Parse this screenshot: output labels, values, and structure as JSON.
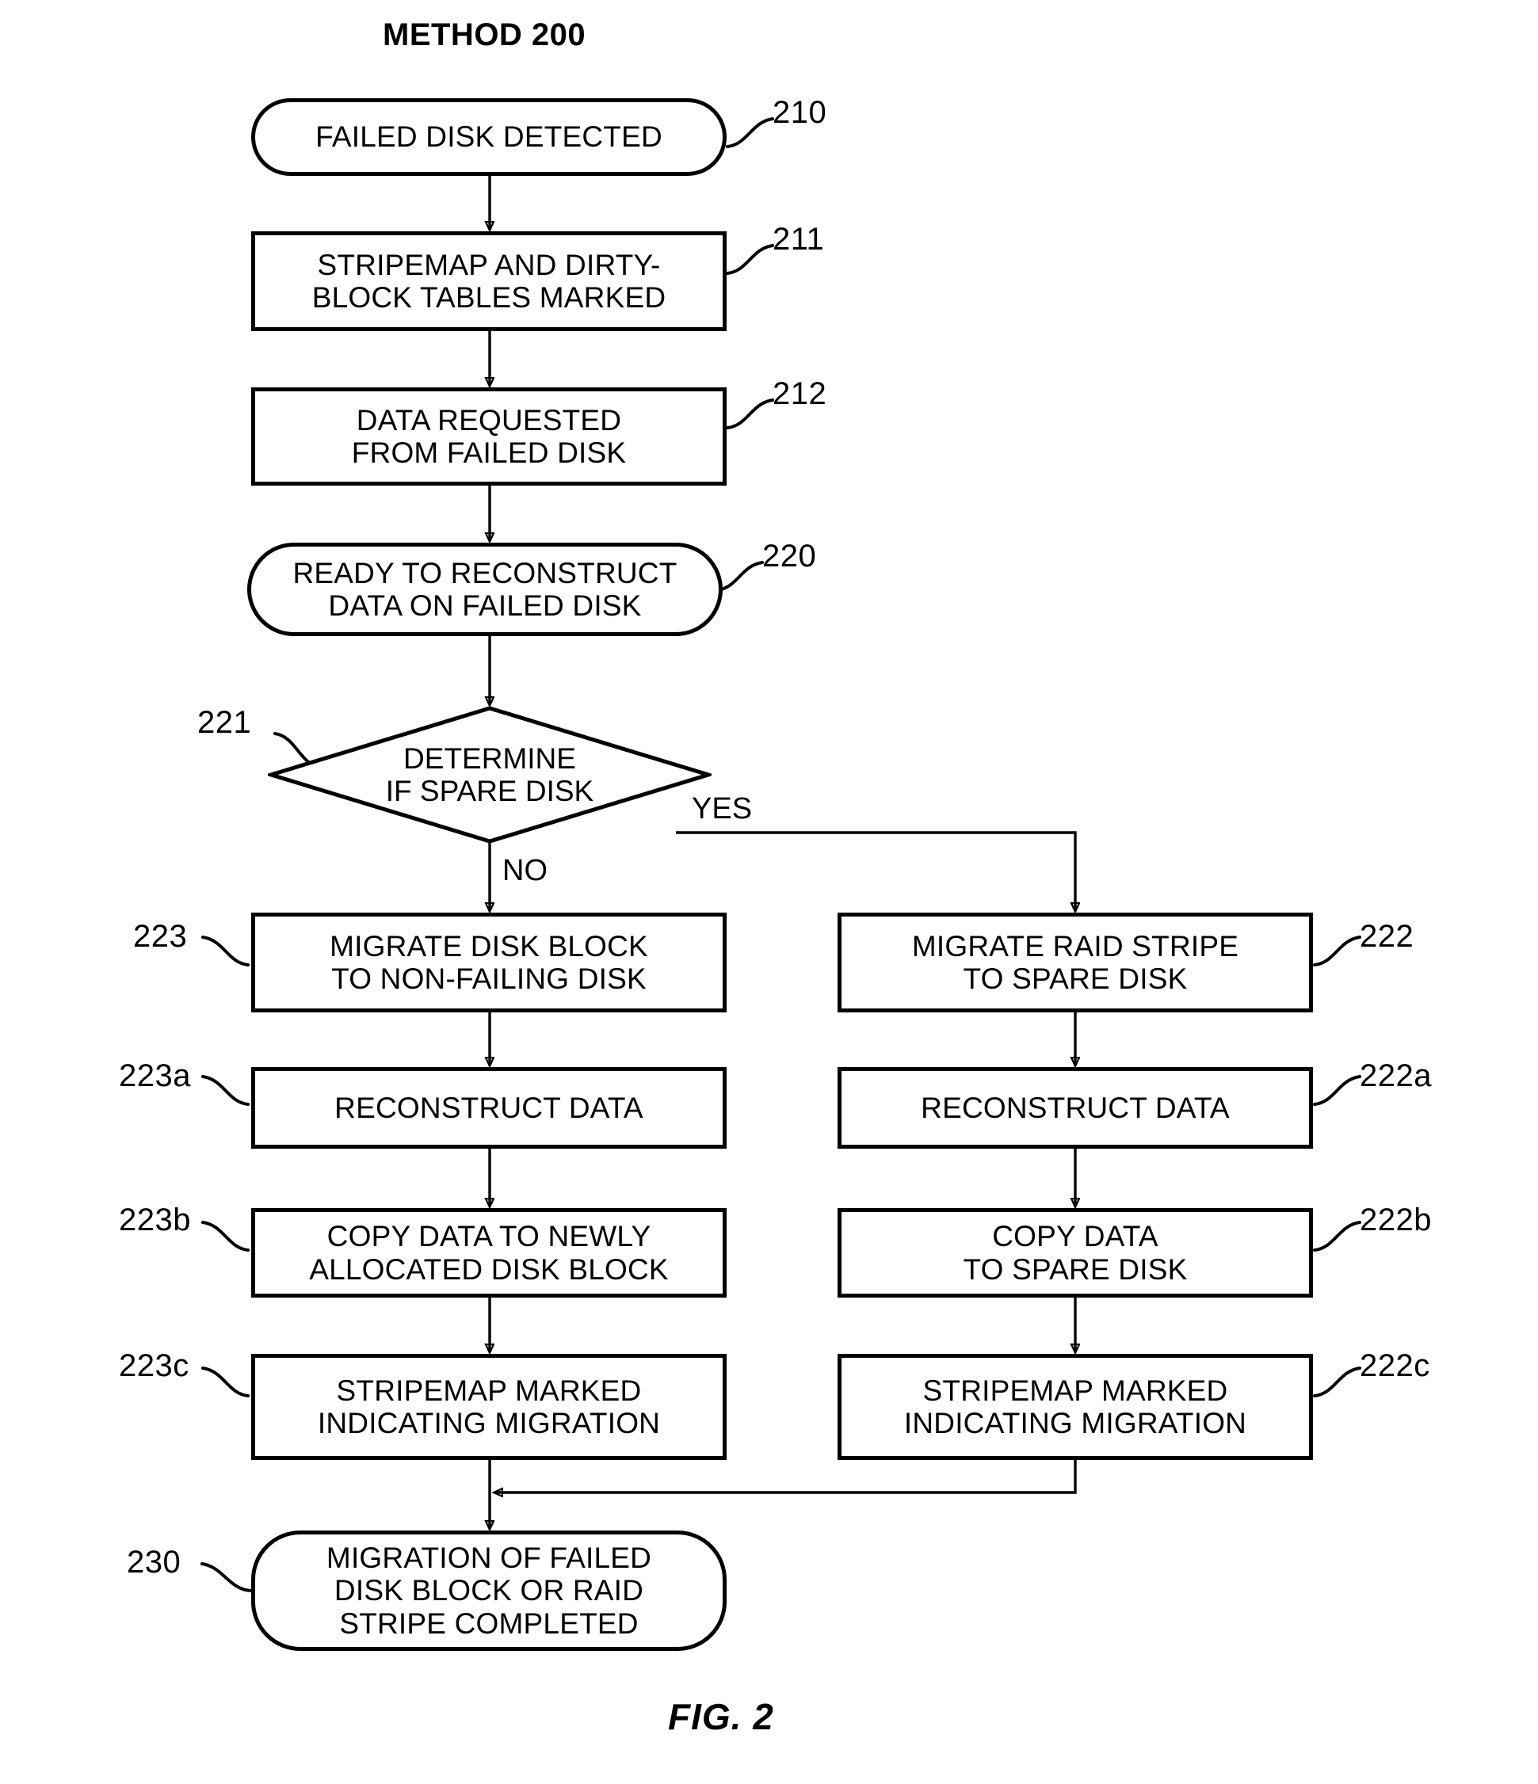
{
  "figure": {
    "title": "METHOD 200",
    "caption": "FIG. 2",
    "type": "flowchart",
    "stroke_color": "#000000",
    "background_color": "#ffffff"
  },
  "nodes": {
    "n210": {
      "ref": "210",
      "shape": "terminal",
      "text": "FAILED DISK DETECTED"
    },
    "n211": {
      "ref": "211",
      "shape": "process",
      "text": "STRIPEMAP AND DIRTY-\nBLOCK TABLES MARKED"
    },
    "n212": {
      "ref": "212",
      "shape": "process",
      "text": "DATA REQUESTED\nFROM FAILED DISK"
    },
    "n220": {
      "ref": "220",
      "shape": "terminal",
      "text": "READY TO RECONSTRUCT\nDATA ON FAILED DISK"
    },
    "n221": {
      "ref": "221",
      "shape": "decision",
      "text": "DETERMINE\nIF SPARE DISK"
    },
    "n222": {
      "ref": "222",
      "shape": "process",
      "text": "MIGRATE RAID STRIPE\nTO SPARE DISK"
    },
    "n222a": {
      "ref": "222a",
      "shape": "process",
      "text": "RECONSTRUCT DATA"
    },
    "n222b": {
      "ref": "222b",
      "shape": "process",
      "text": "COPY DATA\nTO SPARE DISK"
    },
    "n222c": {
      "ref": "222c",
      "shape": "process",
      "text": "STRIPEMAP MARKED\nINDICATING MIGRATION"
    },
    "n223": {
      "ref": "223",
      "shape": "process",
      "text": "MIGRATE DISK BLOCK\nTO NON-FAILING DISK"
    },
    "n223a": {
      "ref": "223a",
      "shape": "process",
      "text": "RECONSTRUCT DATA"
    },
    "n223b": {
      "ref": "223b",
      "shape": "process",
      "text": "COPY DATA TO NEWLY\nALLOCATED DISK BLOCK"
    },
    "n223c": {
      "ref": "223c",
      "shape": "process",
      "text": "STRIPEMAP MARKED\nINDICATING MIGRATION"
    },
    "n230": {
      "ref": "230",
      "shape": "terminal",
      "text": "MIGRATION OF FAILED\nDISK BLOCK OR RAID\nSTRIPE COMPLETED"
    }
  },
  "branch_labels": {
    "yes": "YES",
    "no": "NO"
  },
  "edges": [
    {
      "from": "n210",
      "to": "n211",
      "label": ""
    },
    {
      "from": "n211",
      "to": "n212",
      "label": ""
    },
    {
      "from": "n212",
      "to": "n220",
      "label": ""
    },
    {
      "from": "n220",
      "to": "n221",
      "label": ""
    },
    {
      "from": "n221",
      "to": "n222",
      "label": "YES"
    },
    {
      "from": "n221",
      "to": "n223",
      "label": "NO"
    },
    {
      "from": "n222",
      "to": "n222a",
      "label": ""
    },
    {
      "from": "n222a",
      "to": "n222b",
      "label": ""
    },
    {
      "from": "n222b",
      "to": "n222c",
      "label": ""
    },
    {
      "from": "n222c",
      "to": "n230",
      "label": ""
    },
    {
      "from": "n223",
      "to": "n223a",
      "label": ""
    },
    {
      "from": "n223a",
      "to": "n223b",
      "label": ""
    },
    {
      "from": "n223b",
      "to": "n223c",
      "label": ""
    },
    {
      "from": "n223c",
      "to": "n230",
      "label": ""
    }
  ]
}
